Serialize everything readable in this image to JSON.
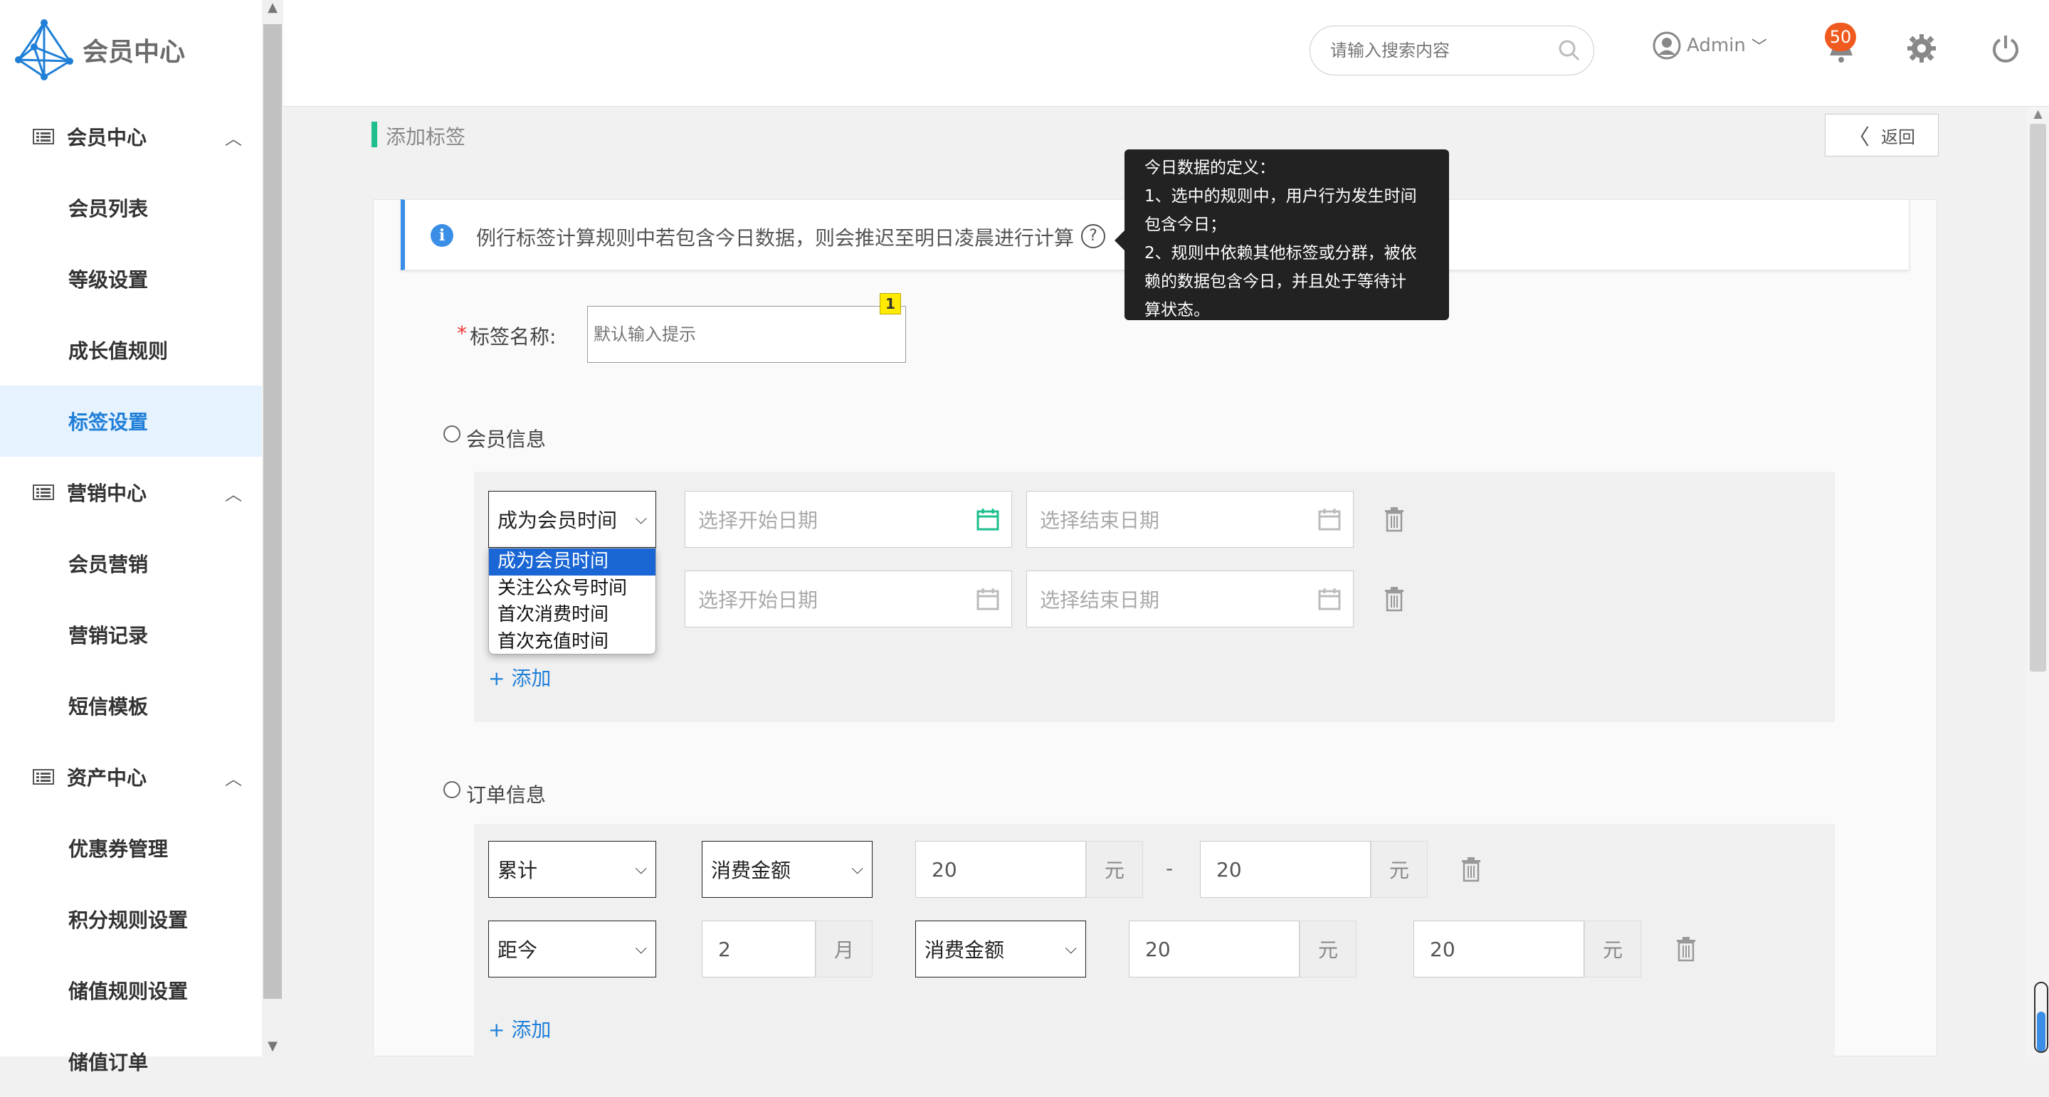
{
  "sidebar": {
    "logo_text": "会员中心",
    "groups": [
      {
        "label": "会员中心",
        "items": [
          "会员列表",
          "等级设置",
          "成长值规则",
          "标签设置"
        ]
      },
      {
        "label": "营销中心",
        "items": [
          "会员营销",
          "营销记录",
          "短信模板"
        ]
      },
      {
        "label": "资产中心",
        "items": [
          "优惠券管理",
          "积分规则设置",
          "储值规则设置",
          "储值订单"
        ]
      }
    ],
    "active_item": "标签设置"
  },
  "header": {
    "search_placeholder": "请输入搜索内容",
    "user_name": "Admin",
    "notification_count": "50"
  },
  "page": {
    "title": "添加标签",
    "back_label": "返回"
  },
  "notice": {
    "text": "例行标签计算规则中若包含今日数据，则会推迟至明日凌晨进行计算",
    "help_symbol": "?"
  },
  "tooltip": {
    "lines": [
      "今日数据的定义：",
      "1、选中的规则中，用户行为发生时间",
      "包含今日；",
      "2、规则中依赖其他标签或分群，被依",
      "赖的数据包含今日，并且处于等待计",
      "算状态。"
    ]
  },
  "form": {
    "name_required_mark": "*",
    "name_label": "标签名称:",
    "name_placeholder": "默认输入提示",
    "annotation_number": "1",
    "member_section": {
      "label": "会员信息",
      "row1_select": "成为会员时间",
      "start_placeholder": "选择开始日期",
      "end_placeholder": "选择结束日期",
      "dropdown_options": [
        "成为会员时间",
        "关注公众号时间",
        "首次消费时间",
        "首次充值时间"
      ],
      "add_label": "+ 添加"
    },
    "order_section": {
      "label": "订单信息",
      "row1": {
        "select_a": "累计",
        "select_b": "消费金额",
        "min": "20",
        "max": "20",
        "unit": "元",
        "dash": "-"
      },
      "row2": {
        "select_a": "距今",
        "months": "2",
        "month_unit": "月",
        "select_b": "消费金额",
        "min": "20",
        "max": "20",
        "unit": "元"
      },
      "add_label": "+ 添加"
    }
  },
  "colors": {
    "accent_green": "#1dbf8e",
    "link_blue": "#1f7fd8",
    "badge_orange": "#f05a1e",
    "tooltip_bg": "#222222"
  }
}
